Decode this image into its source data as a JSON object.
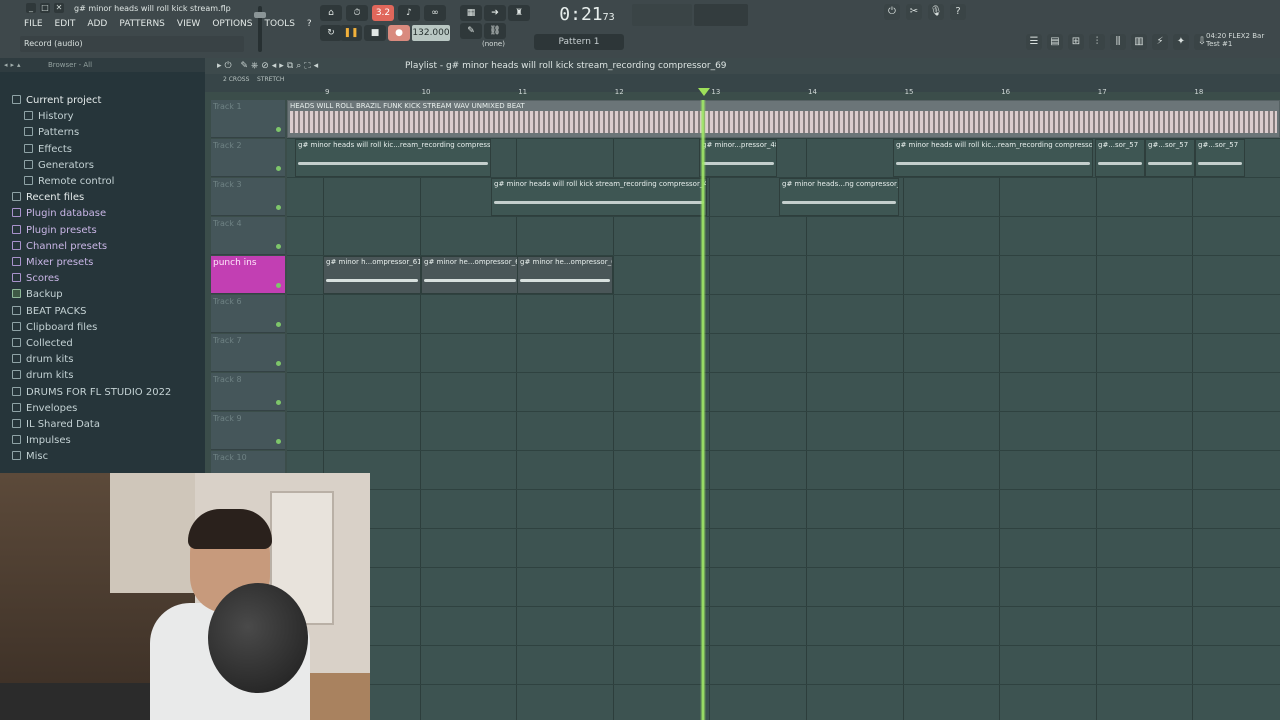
{
  "window": {
    "project_file": "g# minor heads will roll kick stream.flp",
    "controls": [
      "_",
      "□",
      "✕"
    ]
  },
  "menu": [
    "FILE",
    "EDIT",
    "ADD",
    "PATTERNS",
    "VIEW",
    "OPTIONS",
    "TOOLS",
    "?"
  ],
  "hint_bar": "Record (audio)",
  "transport": {
    "tempo": "132.000",
    "time_main": "0:21",
    "time_frac": "73",
    "pattern": "Pattern 1",
    "none_label": "(none)",
    "countdown_label": "3.2",
    "play_icon": "pause-icon",
    "stop_icon": "stop-icon",
    "record_icon": "record-icon",
    "colors": {
      "record": "#d98a7e",
      "accent": "#f2b13a"
    }
  },
  "news": {
    "line1": "04:20  FLEX2 Bar",
    "line2": "Test #1"
  },
  "browser": {
    "header": "Browser - All",
    "items": [
      {
        "label": "Current project",
        "style": "white"
      },
      {
        "label": "History",
        "style": "sub"
      },
      {
        "label": "Patterns",
        "style": "sub"
      },
      {
        "label": "Effects",
        "style": "sub"
      },
      {
        "label": "Generators",
        "style": "sub"
      },
      {
        "label": "Remote control",
        "style": "sub"
      },
      {
        "label": "Recent files",
        "style": "white"
      },
      {
        "label": "Plugin database",
        "style": "purple"
      },
      {
        "label": "Plugin presets",
        "style": "purple"
      },
      {
        "label": "Channel presets",
        "style": "purple"
      },
      {
        "label": "Mixer presets",
        "style": "purple"
      },
      {
        "label": "Scores",
        "style": "purple"
      },
      {
        "label": "Backup",
        "style": "green"
      },
      {
        "label": "BEAT PACKS",
        "style": "plain"
      },
      {
        "label": "Clipboard files",
        "style": "plain"
      },
      {
        "label": "Collected",
        "style": "plain"
      },
      {
        "label": "drum kits",
        "style": "plain"
      },
      {
        "label": "drum kits",
        "style": "plain"
      },
      {
        "label": "DRUMS FOR FL STUDIO 2022",
        "style": "plain"
      },
      {
        "label": "Envelopes",
        "style": "plain"
      },
      {
        "label": "IL Shared Data",
        "style": "plain"
      },
      {
        "label": "Impulses",
        "style": "plain"
      },
      {
        "label": "Misc",
        "style": "plain"
      }
    ]
  },
  "playlist": {
    "title": "Playlist - g# minor heads will roll kick stream_recording compressor_69",
    "ruler": [
      "9",
      "10",
      "11",
      "12",
      "13",
      "14",
      "15",
      "16",
      "17",
      "18"
    ],
    "snap_labels": [
      "2 CROSS",
      "STRETCH"
    ],
    "tracks": [
      {
        "name": "Track 1"
      },
      {
        "name": "Track 2"
      },
      {
        "name": "Track 3"
      },
      {
        "name": "Track 4"
      },
      {
        "name": "punch ins"
      },
      {
        "name": "Track 6"
      },
      {
        "name": "Track 7"
      },
      {
        "name": "Track 8"
      },
      {
        "name": "Track 9"
      },
      {
        "name": "Track 10"
      }
    ],
    "clips": [
      {
        "track": 0,
        "label": "HEADS WILL ROLL BRAZIL FUNK KICK STREAM WAV UNMIXED BEAT",
        "style": "pink"
      },
      {
        "track": 1,
        "label": "g# minor heads will roll kic...ream_recording compressor_43",
        "style": "audio"
      },
      {
        "track": 1,
        "label": "g# minor...pressor_48",
        "style": "audio"
      },
      {
        "track": 1,
        "label": "g# minor heads will roll kic...ream_recording compressor_57",
        "style": "audio"
      },
      {
        "track": 1,
        "label": "g#...sor_57",
        "style": "audio"
      },
      {
        "track": 1,
        "label": "g#...sor_57",
        "style": "audio"
      },
      {
        "track": 1,
        "label": "g#...sor_57",
        "style": "audio"
      },
      {
        "track": 2,
        "label": "g# minor heads will roll kick stream_recording compressor_44",
        "style": "audio"
      },
      {
        "track": 2,
        "label": "g# minor heads...ng compressor_50",
        "style": "audio"
      },
      {
        "track": 4,
        "label": "g# minor h...ompressor_61",
        "style": "punch"
      },
      {
        "track": 4,
        "label": "g# minor he...ompressor_65",
        "style": "punch"
      },
      {
        "track": 4,
        "label": "g# minor he...ompressor_66",
        "style": "punch"
      }
    ],
    "colors": {
      "punch_track": "#c23fb3",
      "playhead": "#9be562"
    }
  }
}
